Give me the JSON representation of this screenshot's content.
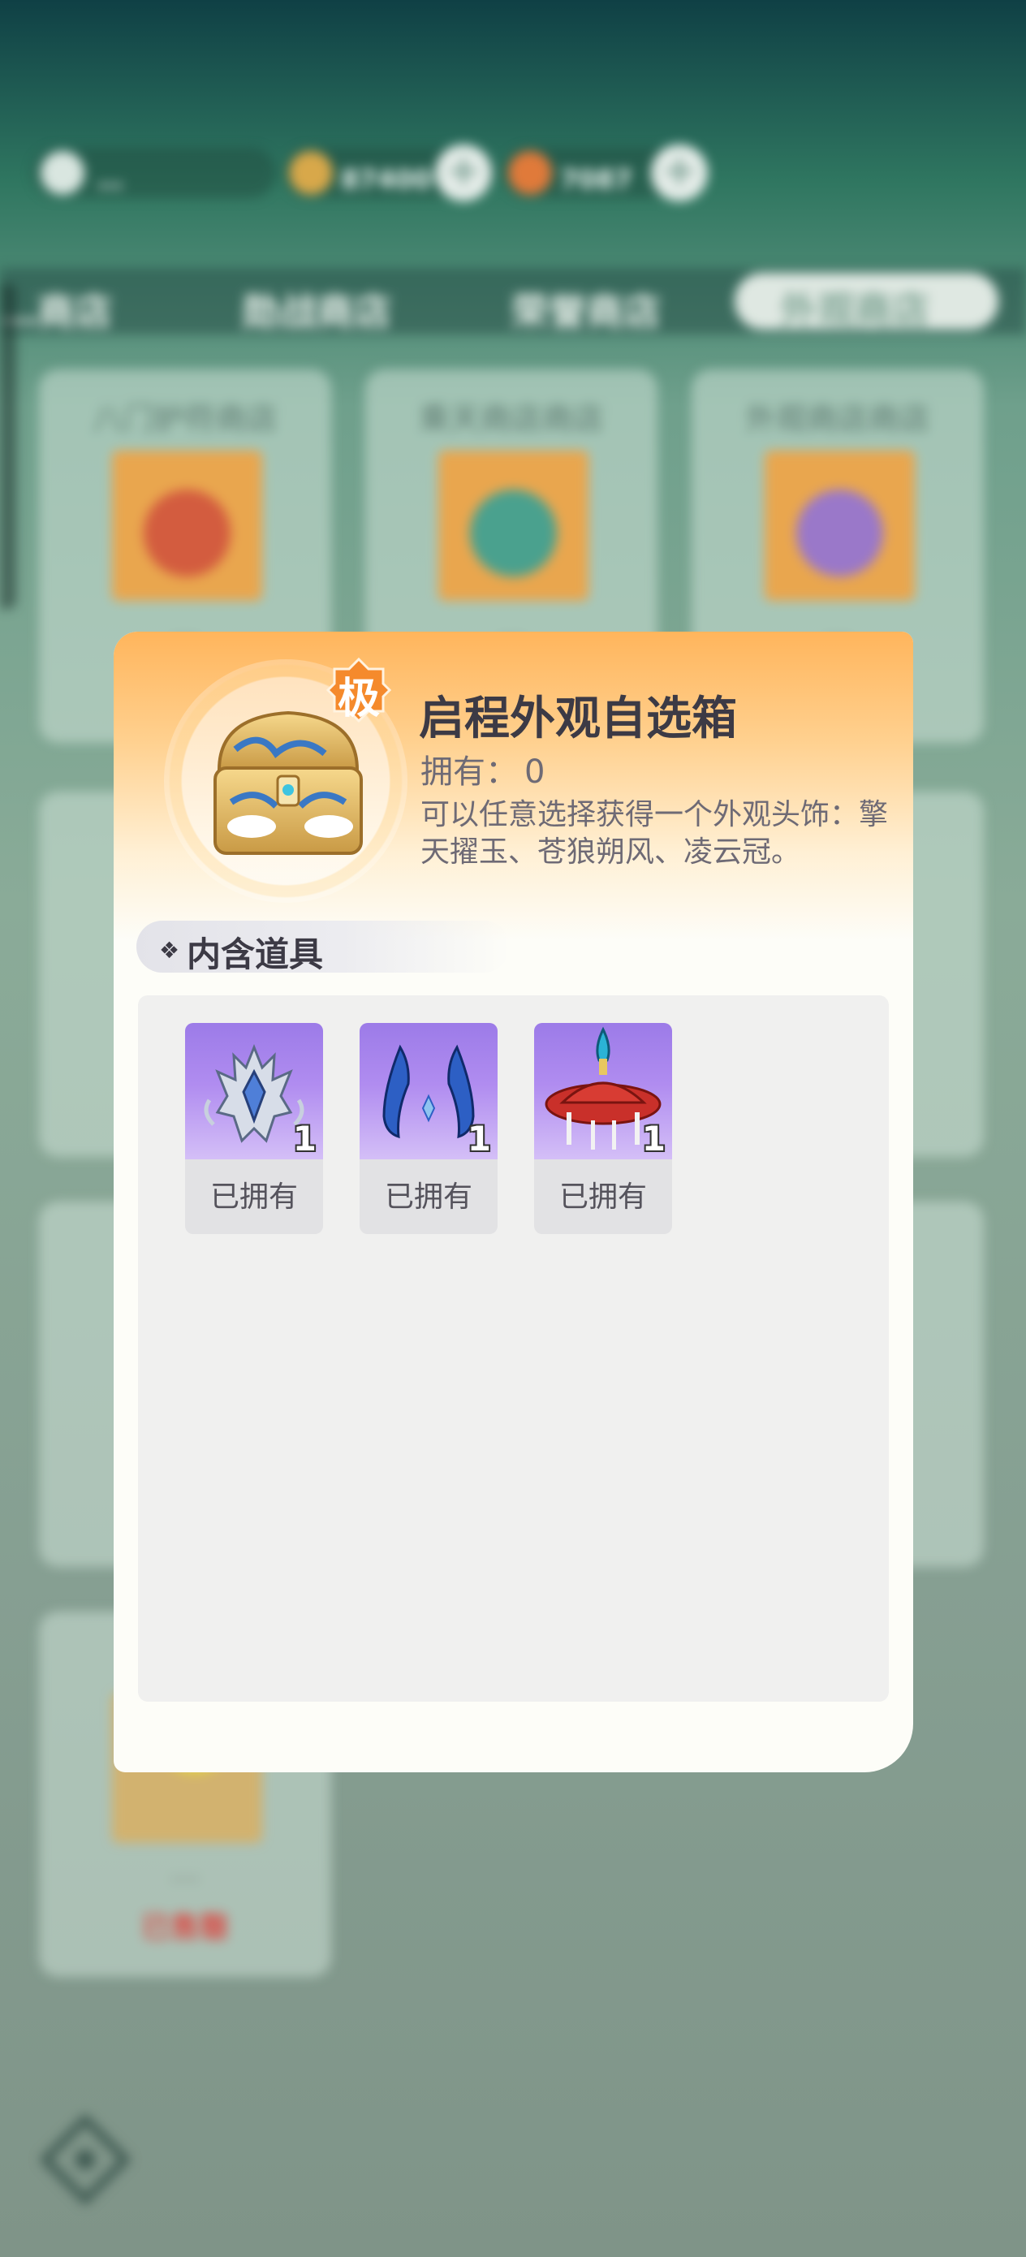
{
  "background": {
    "currency": [
      {
        "name": "stamina",
        "value": "…",
        "icon": "stamina-icon"
      },
      {
        "name": "gold",
        "value": "87400",
        "icon": "gold-coin-icon"
      },
      {
        "name": "gem",
        "value": "7087",
        "icon": "gem-icon"
      }
    ],
    "tabs": [
      "…商店",
      "勋战商店",
      "荣誉商店",
      "外观商店"
    ],
    "active_tab": "外观商店",
    "cards": [
      {
        "title": "八门护符商店",
        "price": "…"
      },
      {
        "title": "乘天商店商店",
        "price": "…"
      },
      {
        "title": "外观商店商店",
        "price": "…"
      },
      {
        "title": "…",
        "price": "…",
        "sold": "已售罄"
      }
    ]
  },
  "modal": {
    "rarity_badge": "极",
    "title": "启程外观自选箱",
    "owned_label": "拥有：",
    "owned_count": "0",
    "description": "可以任意选择获得一个外观头饰：擎天擢玉、苍狼朔风、凌云冠。",
    "section_label": "内含道具",
    "items": [
      {
        "icon": "silver-crown-icon",
        "quantity": "1",
        "status": "已拥有"
      },
      {
        "icon": "blue-horns-icon",
        "quantity": "1",
        "status": "已拥有"
      },
      {
        "icon": "red-hat-icon",
        "quantity": "1",
        "status": "已拥有"
      }
    ]
  },
  "colors": {
    "item_bg": "#9c7be8",
    "header_orange": "#ffb55c",
    "title_text": "#3c3a45"
  }
}
